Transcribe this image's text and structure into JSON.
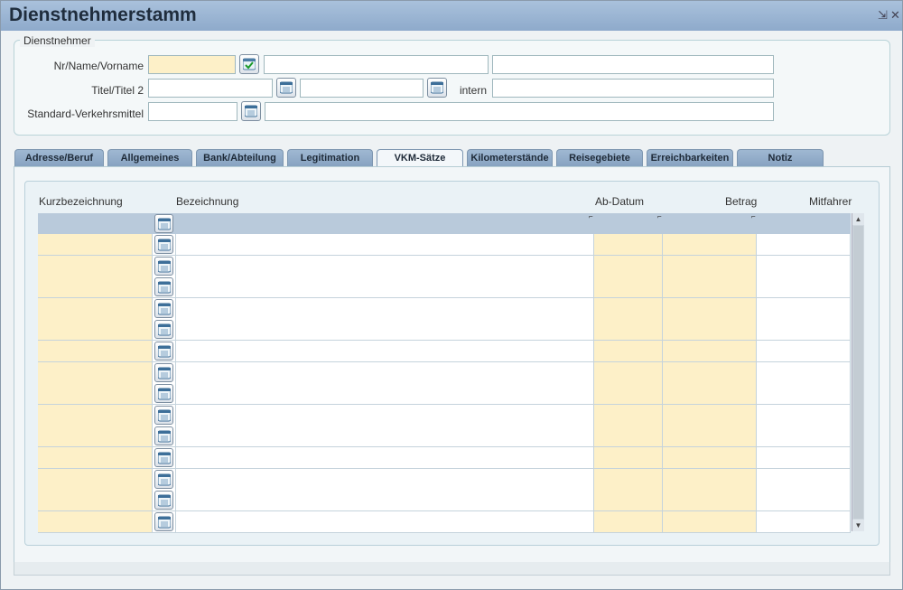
{
  "window": {
    "title": "Dienstnehmerstamm",
    "pin_glyph": "⇲",
    "close_glyph": "✕"
  },
  "dienstnehmer": {
    "legend": "Dienstnehmer",
    "nr_label": "Nr/Name/Vorname",
    "titel_label": "Titel/Titel 2",
    "intern_label": "intern",
    "vkm_label": "Standard-Verkehrsmittel",
    "nr_value": "",
    "name_value": "",
    "vorname_value": "",
    "titel_value": "",
    "titel2_value": "",
    "intern_value": "",
    "vkm_code_value": "",
    "vkm_desc_value": ""
  },
  "tabs": [
    {
      "label": "Adresse/Beruf"
    },
    {
      "label": "Allgemeines"
    },
    {
      "label": "Bank/Abteilung"
    },
    {
      "label": "Legitimation"
    },
    {
      "label": "VKM-Sätze",
      "active": true
    },
    {
      "label": "Kilometerstände"
    },
    {
      "label": "Reisegebiete"
    },
    {
      "label": "Erreichbarkeiten"
    },
    {
      "label": "Notiz"
    }
  ],
  "table": {
    "columns": {
      "kurz": "Kurzbezeichnung",
      "bez": "Bezeichnung",
      "datum": "Ab-Datum",
      "betrag": "Betrag",
      "mitfahrer": "Mitfahrer"
    },
    "sort_glyph": "⌐",
    "row_count": 14,
    "rows": []
  },
  "icons": {
    "confirm": "check-icon",
    "lookup": "calendar-lookup-icon"
  },
  "colors": {
    "accent": "#8eaacb",
    "key_field": "#fdf0c8",
    "header_row": "#b9cadb"
  }
}
